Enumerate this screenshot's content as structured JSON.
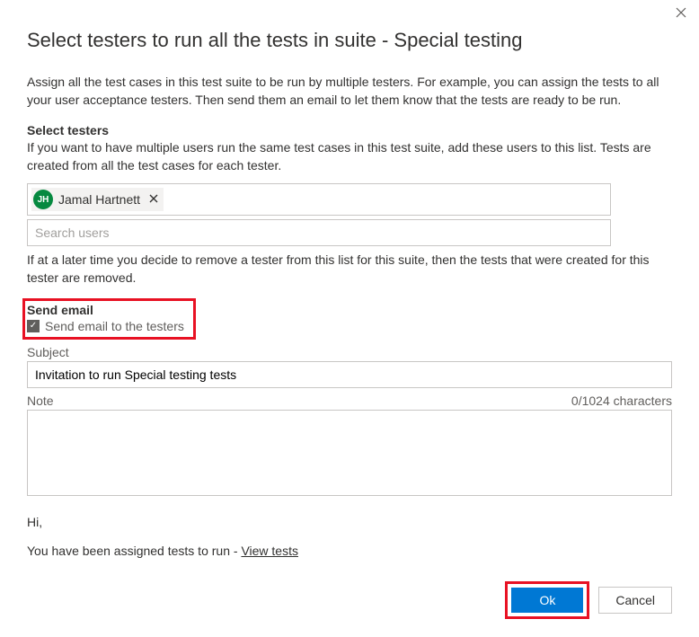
{
  "dialog": {
    "title": "Select testers to run all the tests in suite - Special testing",
    "intro": "Assign all the test cases in this test suite to be run by multiple testers. For example, you can assign the tests to all your user acceptance testers. Then send them an email to let them know that the tests are ready to be run."
  },
  "testers": {
    "heading": "Select testers",
    "help": "If you want to have multiple users run the same test cases in this test suite, add these users to this list. Tests are created from all the test cases for each tester.",
    "selected": [
      {
        "initials": "JH",
        "name": "Jamal Hartnett"
      }
    ],
    "search_placeholder": "Search users",
    "remove_note": "If at a later time you decide to remove a tester from this list for this suite, then the tests that were created for this tester are removed."
  },
  "email": {
    "heading": "Send email",
    "checkbox_label": "Send email to the testers",
    "checked": true,
    "subject_label": "Subject",
    "subject_value": "Invitation to run Special testing tests",
    "note_label": "Note",
    "note_counter": "0/1024 characters",
    "note_value": ""
  },
  "preview": {
    "greeting": "Hi,",
    "body_prefix": "You have been assigned tests to run - ",
    "link_text": "View tests"
  },
  "buttons": {
    "ok": "Ok",
    "cancel": "Cancel"
  }
}
